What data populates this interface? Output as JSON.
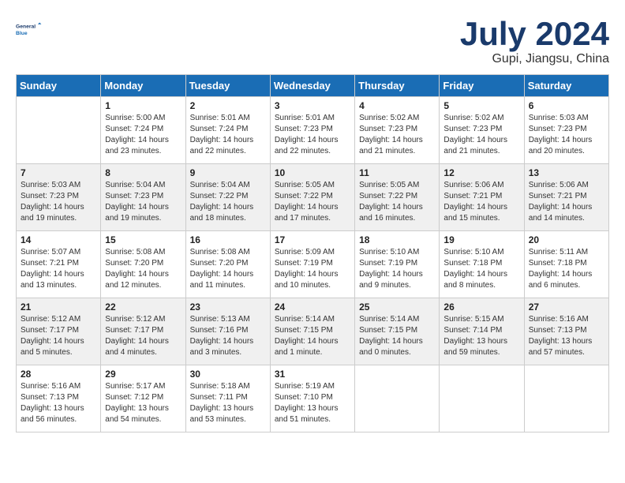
{
  "header": {
    "logo_line1": "General",
    "logo_line2": "Blue",
    "month_title": "July 2024",
    "location": "Gupi, Jiangsu, China"
  },
  "weekdays": [
    "Sunday",
    "Monday",
    "Tuesday",
    "Wednesday",
    "Thursday",
    "Friday",
    "Saturday"
  ],
  "weeks": [
    [
      {
        "day": "",
        "info": ""
      },
      {
        "day": "1",
        "info": "Sunrise: 5:00 AM\nSunset: 7:24 PM\nDaylight: 14 hours\nand 23 minutes."
      },
      {
        "day": "2",
        "info": "Sunrise: 5:01 AM\nSunset: 7:24 PM\nDaylight: 14 hours\nand 22 minutes."
      },
      {
        "day": "3",
        "info": "Sunrise: 5:01 AM\nSunset: 7:23 PM\nDaylight: 14 hours\nand 22 minutes."
      },
      {
        "day": "4",
        "info": "Sunrise: 5:02 AM\nSunset: 7:23 PM\nDaylight: 14 hours\nand 21 minutes."
      },
      {
        "day": "5",
        "info": "Sunrise: 5:02 AM\nSunset: 7:23 PM\nDaylight: 14 hours\nand 21 minutes."
      },
      {
        "day": "6",
        "info": "Sunrise: 5:03 AM\nSunset: 7:23 PM\nDaylight: 14 hours\nand 20 minutes."
      }
    ],
    [
      {
        "day": "7",
        "info": "Sunrise: 5:03 AM\nSunset: 7:23 PM\nDaylight: 14 hours\nand 19 minutes."
      },
      {
        "day": "8",
        "info": "Sunrise: 5:04 AM\nSunset: 7:23 PM\nDaylight: 14 hours\nand 19 minutes."
      },
      {
        "day": "9",
        "info": "Sunrise: 5:04 AM\nSunset: 7:22 PM\nDaylight: 14 hours\nand 18 minutes."
      },
      {
        "day": "10",
        "info": "Sunrise: 5:05 AM\nSunset: 7:22 PM\nDaylight: 14 hours\nand 17 minutes."
      },
      {
        "day": "11",
        "info": "Sunrise: 5:05 AM\nSunset: 7:22 PM\nDaylight: 14 hours\nand 16 minutes."
      },
      {
        "day": "12",
        "info": "Sunrise: 5:06 AM\nSunset: 7:21 PM\nDaylight: 14 hours\nand 15 minutes."
      },
      {
        "day": "13",
        "info": "Sunrise: 5:06 AM\nSunset: 7:21 PM\nDaylight: 14 hours\nand 14 minutes."
      }
    ],
    [
      {
        "day": "14",
        "info": "Sunrise: 5:07 AM\nSunset: 7:21 PM\nDaylight: 14 hours\nand 13 minutes."
      },
      {
        "day": "15",
        "info": "Sunrise: 5:08 AM\nSunset: 7:20 PM\nDaylight: 14 hours\nand 12 minutes."
      },
      {
        "day": "16",
        "info": "Sunrise: 5:08 AM\nSunset: 7:20 PM\nDaylight: 14 hours\nand 11 minutes."
      },
      {
        "day": "17",
        "info": "Sunrise: 5:09 AM\nSunset: 7:19 PM\nDaylight: 14 hours\nand 10 minutes."
      },
      {
        "day": "18",
        "info": "Sunrise: 5:10 AM\nSunset: 7:19 PM\nDaylight: 14 hours\nand 9 minutes."
      },
      {
        "day": "19",
        "info": "Sunrise: 5:10 AM\nSunset: 7:18 PM\nDaylight: 14 hours\nand 8 minutes."
      },
      {
        "day": "20",
        "info": "Sunrise: 5:11 AM\nSunset: 7:18 PM\nDaylight: 14 hours\nand 6 minutes."
      }
    ],
    [
      {
        "day": "21",
        "info": "Sunrise: 5:12 AM\nSunset: 7:17 PM\nDaylight: 14 hours\nand 5 minutes."
      },
      {
        "day": "22",
        "info": "Sunrise: 5:12 AM\nSunset: 7:17 PM\nDaylight: 14 hours\nand 4 minutes."
      },
      {
        "day": "23",
        "info": "Sunrise: 5:13 AM\nSunset: 7:16 PM\nDaylight: 14 hours\nand 3 minutes."
      },
      {
        "day": "24",
        "info": "Sunrise: 5:14 AM\nSunset: 7:15 PM\nDaylight: 14 hours\nand 1 minute."
      },
      {
        "day": "25",
        "info": "Sunrise: 5:14 AM\nSunset: 7:15 PM\nDaylight: 14 hours\nand 0 minutes."
      },
      {
        "day": "26",
        "info": "Sunrise: 5:15 AM\nSunset: 7:14 PM\nDaylight: 13 hours\nand 59 minutes."
      },
      {
        "day": "27",
        "info": "Sunrise: 5:16 AM\nSunset: 7:13 PM\nDaylight: 13 hours\nand 57 minutes."
      }
    ],
    [
      {
        "day": "28",
        "info": "Sunrise: 5:16 AM\nSunset: 7:13 PM\nDaylight: 13 hours\nand 56 minutes."
      },
      {
        "day": "29",
        "info": "Sunrise: 5:17 AM\nSunset: 7:12 PM\nDaylight: 13 hours\nand 54 minutes."
      },
      {
        "day": "30",
        "info": "Sunrise: 5:18 AM\nSunset: 7:11 PM\nDaylight: 13 hours\nand 53 minutes."
      },
      {
        "day": "31",
        "info": "Sunrise: 5:19 AM\nSunset: 7:10 PM\nDaylight: 13 hours\nand 51 minutes."
      },
      {
        "day": "",
        "info": ""
      },
      {
        "day": "",
        "info": ""
      },
      {
        "day": "",
        "info": ""
      }
    ]
  ]
}
